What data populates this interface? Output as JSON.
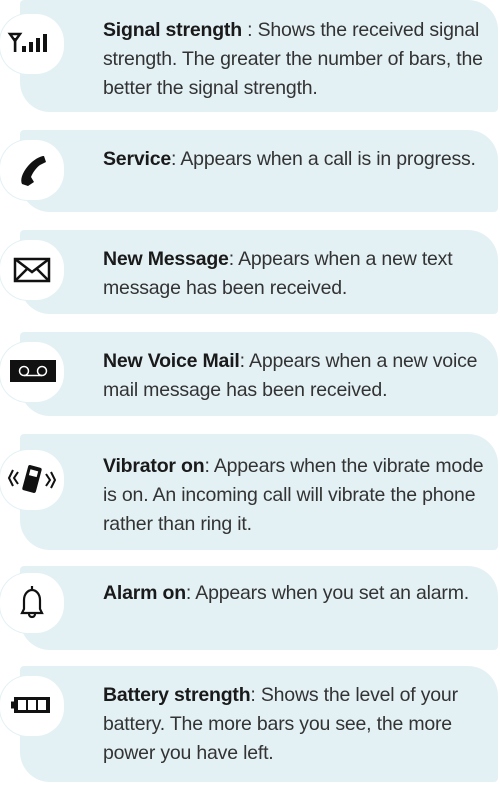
{
  "items": [
    {
      "icon": "signal-strength-icon",
      "title": "Signal strength",
      "sep": " : ",
      "body": "Shows the received signal strength. The greater the number of bars, the better the signal strength."
    },
    {
      "icon": "phone-handset-icon",
      "title": "Service",
      "sep": ": ",
      "body": "Appears when a call is in progress."
    },
    {
      "icon": "envelope-icon",
      "title": "New Message",
      "sep": ": ",
      "body": "Appears when a new text message has been received."
    },
    {
      "icon": "voicemail-icon",
      "title": "New Voice Mail",
      "sep": ": ",
      "body": "Appears when a new voice mail message has been received."
    },
    {
      "icon": "vibrate-icon",
      "title": "Vibrator on",
      "sep": ": ",
      "body": "Appears when the vibrate mode is on. An incoming call will vibrate the phone rather than ring it."
    },
    {
      "icon": "alarm-bell-icon",
      "title": "Alarm on",
      "sep": ": ",
      "body": "Appears when you set an alarm."
    },
    {
      "icon": "battery-icon",
      "title": "Battery strength",
      "sep": ": ",
      "body": "Shows the level of your battery. The more bars you see, the more power you have left."
    }
  ]
}
